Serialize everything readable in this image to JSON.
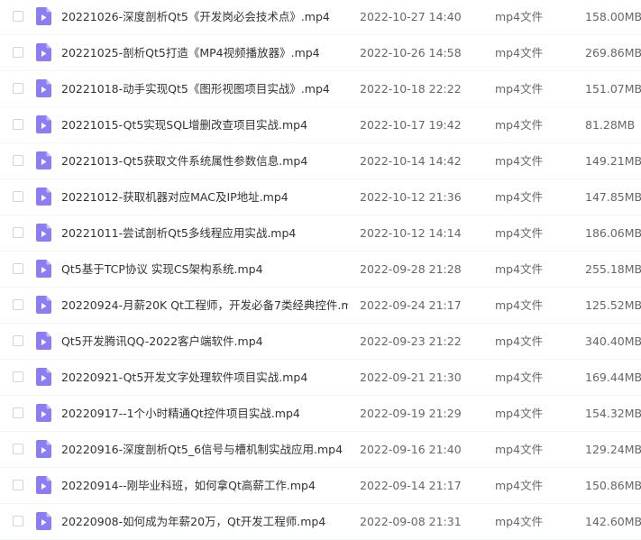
{
  "colors": {
    "icon_primary": "#8b7ef5",
    "icon_fold": "#c3bcfa",
    "text": "#333333",
    "muted": "#666666"
  },
  "icons": {
    "file": "video-file-icon"
  },
  "files": [
    {
      "name": "20221026-深度剖析Qt5《开发岗必会技术点》.mp4",
      "date": "2022-10-27 14:40",
      "type": "mp4文件",
      "size": "158.00MB"
    },
    {
      "name": "20221025-剖析Qt5打造《MP4视频播放器》.mp4",
      "date": "2022-10-26 14:58",
      "type": "mp4文件",
      "size": "269.86MB"
    },
    {
      "name": "20221018-动手实现Qt5《图形视图项目实战》.mp4",
      "date": "2022-10-18 22:22",
      "type": "mp4文件",
      "size": "151.07MB"
    },
    {
      "name": "20221015-Qt5实现SQL增删改查项目实战.mp4",
      "date": "2022-10-17 19:42",
      "type": "mp4文件",
      "size": "81.28MB"
    },
    {
      "name": "20221013-Qt5获取文件系统属性参数信息.mp4",
      "date": "2022-10-14 14:42",
      "type": "mp4文件",
      "size": "149.21MB"
    },
    {
      "name": "20221012-获取机器对应MAC及IP地址.mp4",
      "date": "2022-10-12 21:36",
      "type": "mp4文件",
      "size": "147.85MB"
    },
    {
      "name": "20221011-尝试剖析Qt5多线程应用实战.mp4",
      "date": "2022-10-12 14:14",
      "type": "mp4文件",
      "size": "186.06MB"
    },
    {
      "name": "Qt5基于TCP协议 实现CS架构系统.mp4",
      "date": "2022-09-28 21:28",
      "type": "mp4文件",
      "size": "255.18MB"
    },
    {
      "name": "20220924-月薪20K Qt工程师，开发必备7类经典控件.m...",
      "date": "2022-09-24 21:17",
      "type": "mp4文件",
      "size": "125.52MB"
    },
    {
      "name": "Qt5开发腾讯QQ-2022客户端软件.mp4",
      "date": "2022-09-23 21:22",
      "type": "mp4文件",
      "size": "340.40MB"
    },
    {
      "name": "20220921-Qt5开发文字处理软件项目实战.mp4",
      "date": "2022-09-21 21:30",
      "type": "mp4文件",
      "size": "169.44MB"
    },
    {
      "name": "20220917--1个小时精通Qt控件项目实战.mp4",
      "date": "2022-09-19 21:29",
      "type": "mp4文件",
      "size": "154.32MB"
    },
    {
      "name": "20220916-深度剖析Qt5_6信号与槽机制实战应用.mp4",
      "date": "2022-09-16 21:40",
      "type": "mp4文件",
      "size": "129.24MB"
    },
    {
      "name": "20220914--刚毕业科班，如何拿Qt高薪工作.mp4",
      "date": "2022-09-14 21:17",
      "type": "mp4文件",
      "size": "150.86MB"
    },
    {
      "name": "20220908-如何成为年薪20万，Qt开发工程师.mp4",
      "date": "2022-09-08 21:31",
      "type": "mp4文件",
      "size": "142.60MB"
    }
  ]
}
